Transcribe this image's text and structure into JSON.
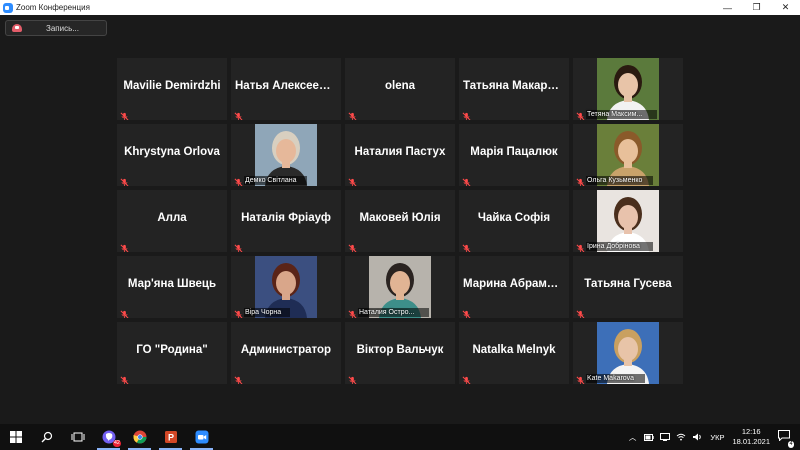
{
  "window": {
    "title": "Zoom Конференция",
    "controls": [
      "—",
      "❐",
      "✕"
    ]
  },
  "recording": {
    "label": "Запись..."
  },
  "participants": [
    {
      "name": "Mavilie  Demirdzhi",
      "video": false
    },
    {
      "name": "Натья  Алексеенко",
      "video": false
    },
    {
      "name": "olena",
      "video": false
    },
    {
      "name": "Татьяна  Макарова",
      "video": false
    },
    {
      "name": "Тетяна Максим...",
      "video": true,
      "bg": "#5b7a3c",
      "skin": "#e8c4a8",
      "hair": "#2a1a10",
      "shirt": "#f2f2f2"
    },
    {
      "name": "Khrystyna Orlova",
      "video": false
    },
    {
      "name": "Демко Світлана",
      "video": true,
      "bg": "#8fa6b8",
      "skin": "#e6b89a",
      "hair": "#d8cfc0",
      "shirt": "#2a2a2a"
    },
    {
      "name": "Наталия Пастух",
      "video": false
    },
    {
      "name": "Марія Пацалюк",
      "video": false
    },
    {
      "name": "Ольга Кузьменко",
      "video": true,
      "bg": "#6a7f3a",
      "skin": "#e8c09a",
      "hair": "#8a5a2a",
      "shirt": "#c9a26a"
    },
    {
      "name": "Алла",
      "video": false
    },
    {
      "name": "Наталія Фріауф",
      "video": false
    },
    {
      "name": "Маковей Юлія",
      "video": false
    },
    {
      "name": "Чайка Софія",
      "video": false
    },
    {
      "name": "Ірина Добрінова",
      "video": true,
      "bg": "#e9e4e0",
      "skin": "#e8c2ac",
      "hair": "#4a2e1c",
      "shirt": "#ffffff"
    },
    {
      "name": "Мар'яна Швець",
      "video": false
    },
    {
      "name": "Віра Чорна",
      "video": true,
      "bg": "#3b4f80",
      "skin": "#d9a68a",
      "hair": "#5a2418",
      "shirt": "#1f2d55"
    },
    {
      "name": "Наталия Остро...",
      "video": true,
      "bg": "#b7b3ac",
      "skin": "#e1b494",
      "hair": "#2a2320",
      "shirt": "#3d8f8a"
    },
    {
      "name": "Марина  Абрамова",
      "video": false
    },
    {
      "name": "Татьяна Гусева",
      "video": false
    },
    {
      "name": "ГО \"Родина\"",
      "video": false
    },
    {
      "name": "Администратор",
      "video": false
    },
    {
      "name": "Віктор Вальчук",
      "video": false
    },
    {
      "name": "Natalka Melnyk",
      "video": false
    },
    {
      "name": "Kate Makarova",
      "video": true,
      "bg": "#3d6fb8",
      "skin": "#e8c4a8",
      "hair": "#c9a060",
      "shirt": "#f4f4f4"
    }
  ],
  "taskbar": {
    "apps": [
      "windows-start-icon",
      "search-icon",
      "task-view-icon",
      "viber-icon",
      "chrome-icon",
      "powerpoint-icon",
      "zoom-icon"
    ],
    "badge": "42",
    "language": "УКР",
    "time": "12:16",
    "date": "18.01.2021",
    "notifications": "4"
  }
}
